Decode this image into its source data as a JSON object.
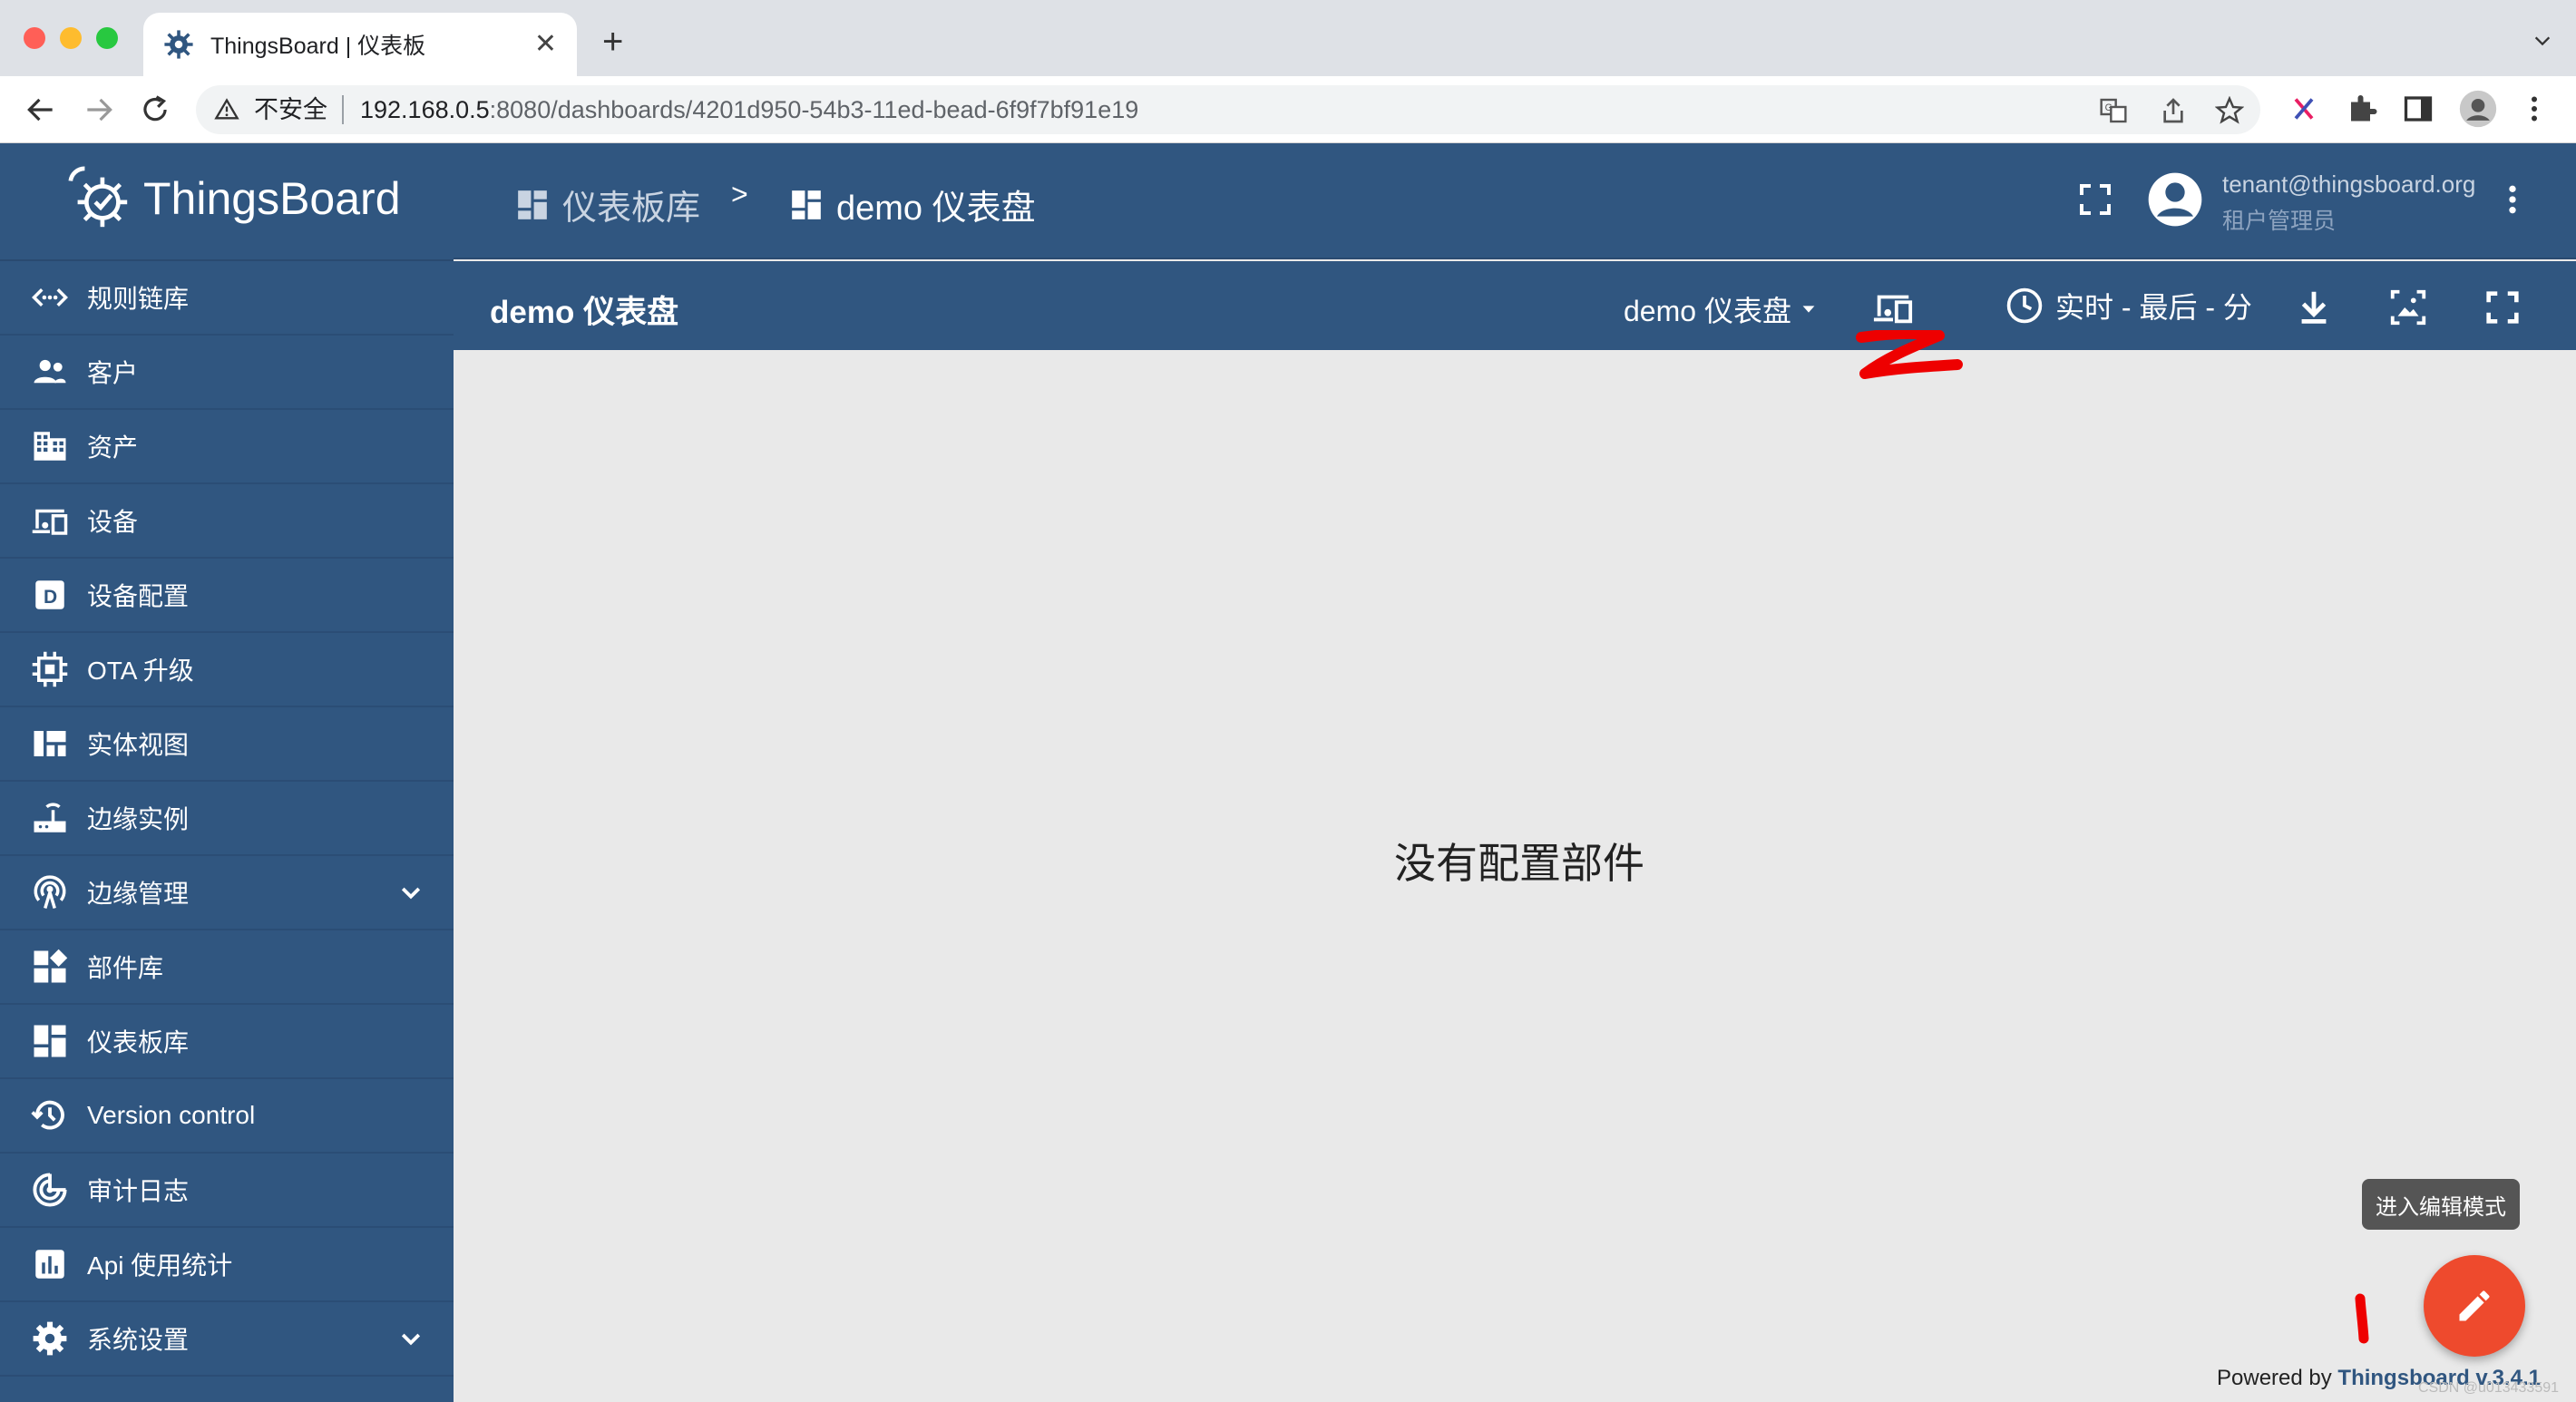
{
  "browser": {
    "tab_title": "ThingsBoard | 仪表板",
    "security_label": "不安全",
    "url_host": "192.168.0.5",
    "url_rest": ":8080/dashboards/4201d950-54b3-11ed-bead-6f9f7bf91e19"
  },
  "app": {
    "logo_text": "ThingsBoard",
    "sidebar": {
      "items": [
        {
          "label": "规则链库",
          "icon": "rule-chain-icon"
        },
        {
          "label": "客户",
          "icon": "customers-icon"
        },
        {
          "label": "资产",
          "icon": "assets-icon"
        },
        {
          "label": "设备",
          "icon": "devices-icon"
        },
        {
          "label": "设备配置",
          "icon": "device-profile-icon"
        },
        {
          "label": "OTA 升级",
          "icon": "ota-icon"
        },
        {
          "label": "实体视图",
          "icon": "entity-view-icon"
        },
        {
          "label": "边缘实例",
          "icon": "edge-icon"
        },
        {
          "label": "边缘管理",
          "icon": "edge-management-icon"
        },
        {
          "label": "部件库",
          "icon": "widgets-icon"
        },
        {
          "label": "仪表板库",
          "icon": "dashboards-icon"
        },
        {
          "label": "Version control",
          "icon": "history-icon"
        },
        {
          "label": "审计日志",
          "icon": "audit-icon"
        },
        {
          "label": "Api 使用统计",
          "icon": "bar-chart-icon"
        },
        {
          "label": "系统设置",
          "icon": "settings-icon"
        }
      ]
    },
    "breadcrumb": {
      "parent": "仪表板库",
      "separator": ">",
      "current": "demo 仪表盘"
    },
    "user": {
      "email": "tenant@thingsboard.org",
      "role": "租户管理员"
    },
    "dashboard": {
      "title": "demo 仪表盘",
      "state_select": "demo 仪表盘",
      "timewindow": "实时 - 最后 - 分",
      "empty_message": "没有配置部件",
      "tooltip": "进入编辑模式"
    },
    "footer": {
      "powered_prefix": "Powered by ",
      "powered_link": "Thingsboard v.3.4.1",
      "watermark": "CSDN @u013433591"
    },
    "colors": {
      "primary": "#305680",
      "fab": "#ee4a2d",
      "content_bg": "#e9e9e9"
    }
  }
}
